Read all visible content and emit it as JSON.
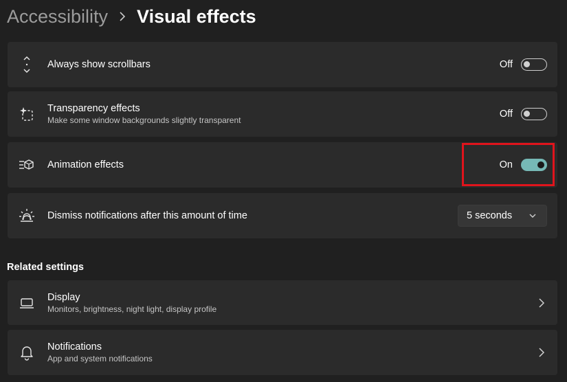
{
  "breadcrumb": {
    "parent": "Accessibility",
    "current": "Visual effects"
  },
  "settings": [
    {
      "title": "Always show scrollbars",
      "subtitle": "",
      "icon": "scrollbar-icon",
      "state_label": "Off",
      "toggle": false
    },
    {
      "title": "Transparency effects",
      "subtitle": "Make some window backgrounds slightly transparent",
      "icon": "transparency-icon",
      "state_label": "Off",
      "toggle": false
    },
    {
      "title": "Animation effects",
      "subtitle": "",
      "icon": "animation-icon",
      "state_label": "On",
      "toggle": true
    },
    {
      "title": "Dismiss notifications after this amount of time",
      "subtitle": "",
      "icon": "sun-dim-icon",
      "dropdown_value": "5 seconds"
    }
  ],
  "related": {
    "heading": "Related settings",
    "items": [
      {
        "title": "Display",
        "subtitle": "Monitors, brightness, night light, display profile",
        "icon": "laptop-icon"
      },
      {
        "title": "Notifications",
        "subtitle": "App and system notifications",
        "icon": "bell-icon"
      }
    ]
  },
  "colors": {
    "background": "#202020",
    "card": "#2b2b2b",
    "accent": "#76b9b6",
    "highlight": "#e0141c"
  }
}
